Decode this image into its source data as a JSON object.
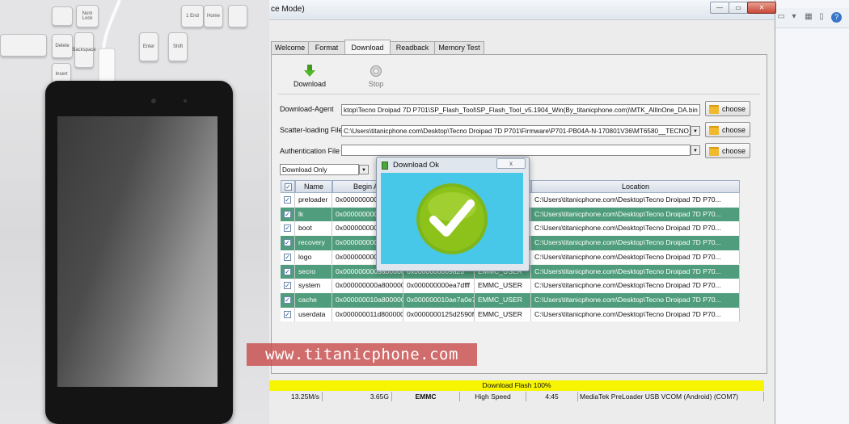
{
  "window": {
    "title": "ce Mode)"
  },
  "tabs": [
    {
      "label": "Welcome"
    },
    {
      "label": "Format"
    },
    {
      "label": "Download",
      "active": true
    },
    {
      "label": "Readback"
    },
    {
      "label": "Memory Test"
    }
  ],
  "actions": {
    "download": "Download",
    "stop": "Stop"
  },
  "form": {
    "download_agent_label": "Download-Agent",
    "download_agent_value": "ktop\\Tecno Droipad 7D P701\\SP_Flash_Tool\\SP_Flash_Tool_v5.1904_Win(By_titanicphone.com)\\MTK_AllInOne_DA.bin",
    "scatter_label": "Scatter-loading File",
    "scatter_value": "C:\\Users\\titanicphone.com\\Desktop\\Tecno Droipad 7D P701\\Firmware\\P701-PB04A-N-170801V36\\MT6580__TECNO_",
    "auth_label": "Authentication File",
    "auth_value": "",
    "choose_label": "choose",
    "mode_value": "Download Only"
  },
  "table": {
    "headers": [
      "Name",
      "Begin Ad",
      "Location"
    ],
    "rows": [
      {
        "name": "preloader",
        "begin": "0x000000000",
        "end": "",
        "region": "",
        "location": "C:\\Users\\titanicphone.com\\Desktop\\Tecno Droipad 7D P70..."
      },
      {
        "name": "lk",
        "begin": "0x000000000",
        "end": "",
        "region": "",
        "location": "C:\\Users\\titanicphone.com\\Desktop\\Tecno Droipad 7D P70..."
      },
      {
        "name": "boot",
        "begin": "0x000000000",
        "end": "",
        "region": "",
        "location": "C:\\Users\\titanicphone.com\\Desktop\\Tecno Droipad 7D P70..."
      },
      {
        "name": "recovery",
        "begin": "0x000000000",
        "end": "",
        "region": "",
        "location": "C:\\Users\\titanicphone.com\\Desktop\\Tecno Droipad 7D P70..."
      },
      {
        "name": "logo",
        "begin": "0x000000000",
        "end": "",
        "region": "",
        "location": "C:\\Users\\titanicphone.com\\Desktop\\Tecno Droipad 7D P70..."
      },
      {
        "name": "secro",
        "begin": "0x0000000009a00000",
        "end": "0x0000000009a20",
        "region": "EMMC_USER",
        "location": "C:\\Users\\titanicphone.com\\Desktop\\Tecno Droipad 7D P70..."
      },
      {
        "name": "system",
        "begin": "0x000000000a800000",
        "end": "0x000000000ea7dfff",
        "region": "EMMC_USER",
        "location": "C:\\Users\\titanicphone.com\\Desktop\\Tecno Droipad 7D P70..."
      },
      {
        "name": "cache",
        "begin": "0x000000010a800000",
        "end": "0x000000010ae7a0e7",
        "region": "EMMC_USER",
        "location": "C:\\Users\\titanicphone.com\\Desktop\\Tecno Droipad 7D P70..."
      },
      {
        "name": "userdata",
        "begin": "0x000000011d800000",
        "end": "0x0000000125d2590f",
        "region": "EMMC_USER",
        "location": "C:\\Users\\titanicphone.com\\Desktop\\Tecno Droipad 7D P70..."
      }
    ]
  },
  "dialog": {
    "title": "Download Ok",
    "close": "x"
  },
  "status": {
    "progress_text": "Download Flash 100%",
    "progress_fraction": 1.0,
    "speed": "13.25M/s",
    "size": "3.65G",
    "storage": "EMMC",
    "mode": "High Speed",
    "time": "4:45",
    "port": "MediaTek PreLoader USB VCOM (Android) (COM7)"
  },
  "watermark": {
    "text": "www.titanicphone.com"
  },
  "keyboard": {
    "keys": [
      "Num Lock",
      "1 End",
      "Delete",
      "Backspace",
      "Enter",
      "Shift",
      "Home",
      "Insert"
    ]
  },
  "colors": {
    "row_highlight": "#4f9d7c",
    "progress": "#f7f500",
    "dialog_body": "#47c8e8",
    "check_green": "#8cc21a",
    "watermark_bg": "#c84646"
  }
}
